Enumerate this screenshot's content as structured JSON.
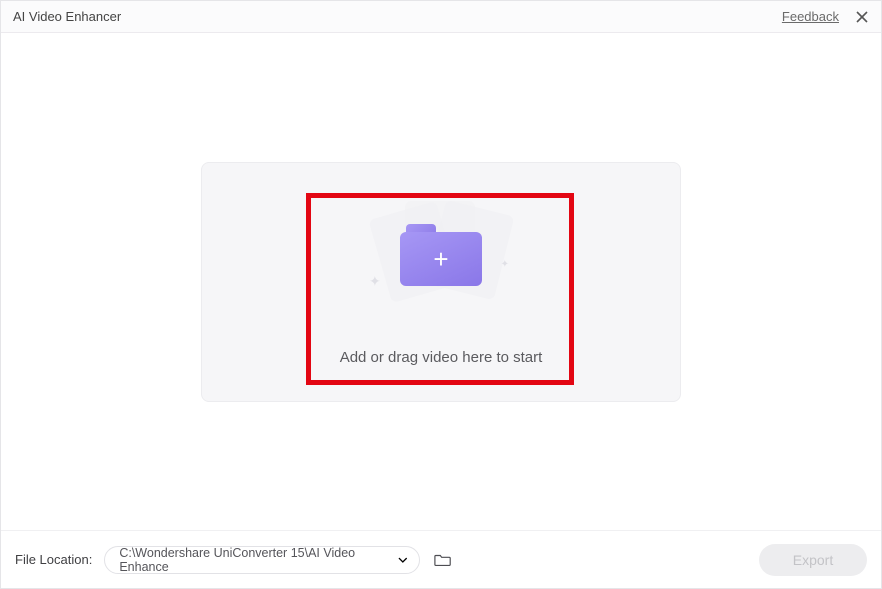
{
  "header": {
    "title": "AI Video Enhancer",
    "feedback": "Feedback"
  },
  "dropzone": {
    "instruction": "Add or drag video here to start"
  },
  "footer": {
    "file_location_label": "File Location:",
    "path": "C:\\Wondershare UniConverter 15\\AI Video Enhance",
    "export_label": "Export"
  },
  "icons": {
    "close": "close-icon",
    "folder_plus": "folder-plus-icon",
    "chevron_down": "chevron-down-icon",
    "browse_folder": "folder-open-icon"
  },
  "colors": {
    "accent": "#8f7de9",
    "highlight_border": "#e30613",
    "panel_bg": "#f6f6f8"
  }
}
